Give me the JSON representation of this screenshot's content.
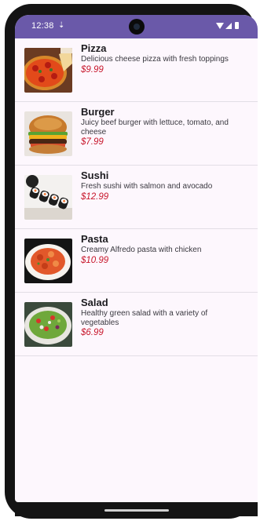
{
  "status_bar": {
    "time": "12:38",
    "notification_icon": "download-icon",
    "icons": [
      "wifi-icon",
      "signal-icon",
      "battery-icon"
    ]
  },
  "menu": {
    "items": [
      {
        "name": "Pizza",
        "description": "Delicious cheese pizza with fresh toppings",
        "price": "$9.99",
        "image": "pizza-image"
      },
      {
        "name": "Burger",
        "description": "Juicy beef burger with lettuce, tomato, and cheese",
        "price": "$7.99",
        "image": "burger-image"
      },
      {
        "name": "Sushi",
        "description": "Fresh sushi with salmon and avocado",
        "price": "$12.99",
        "image": "sushi-image"
      },
      {
        "name": "Pasta",
        "description": "Creamy Alfredo pasta with chicken",
        "price": "$10.99",
        "image": "pasta-image"
      },
      {
        "name": "Salad",
        "description": "Healthy green salad with a variety of vegetables",
        "price": "$6.99",
        "image": "salad-image"
      }
    ]
  },
  "colors": {
    "status_bar": "#6a59a9",
    "background": "#fdf7fd",
    "price": "#c7162b"
  }
}
